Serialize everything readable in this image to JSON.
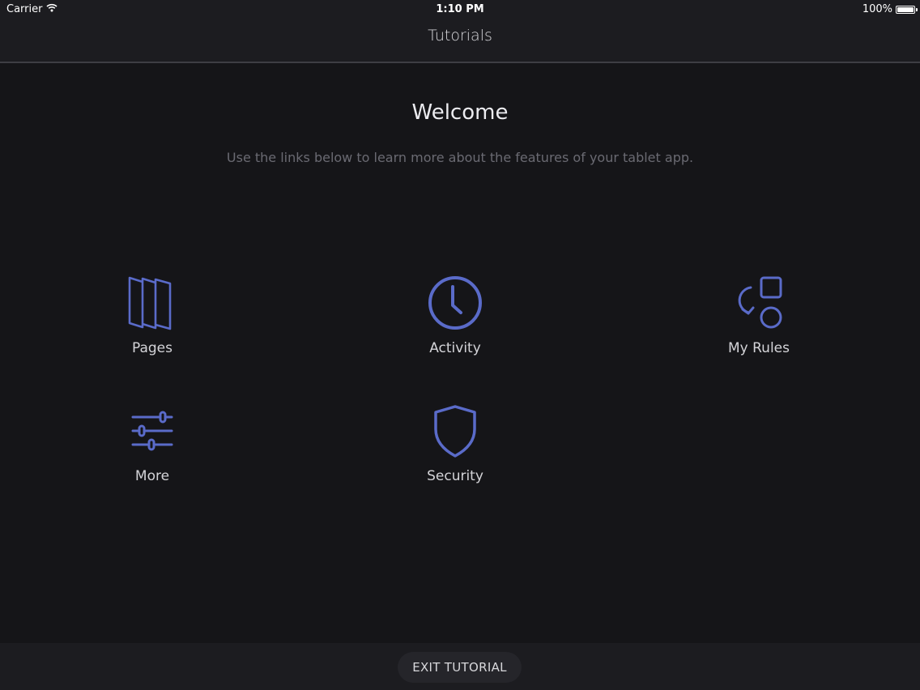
{
  "status_bar": {
    "carrier": "Carrier",
    "time": "1:10 PM",
    "battery": "100%"
  },
  "nav": {
    "title": "Tutorials"
  },
  "welcome": {
    "title": "Welcome",
    "subtitle": "Use the links below to learn more about the features of your tablet app."
  },
  "tiles": [
    {
      "label": "Pages",
      "icon": "pages-icon"
    },
    {
      "label": "Activity",
      "icon": "clock-icon"
    },
    {
      "label": "My Rules",
      "icon": "rules-icon"
    },
    {
      "label": "More",
      "icon": "sliders-icon"
    },
    {
      "label": "Security",
      "icon": "shield-icon"
    }
  ],
  "footer": {
    "exit_label": "EXIT TUTORIAL"
  },
  "colors": {
    "accent": "#5a6bc9",
    "background": "#151518",
    "bar": "#1c1c20"
  }
}
